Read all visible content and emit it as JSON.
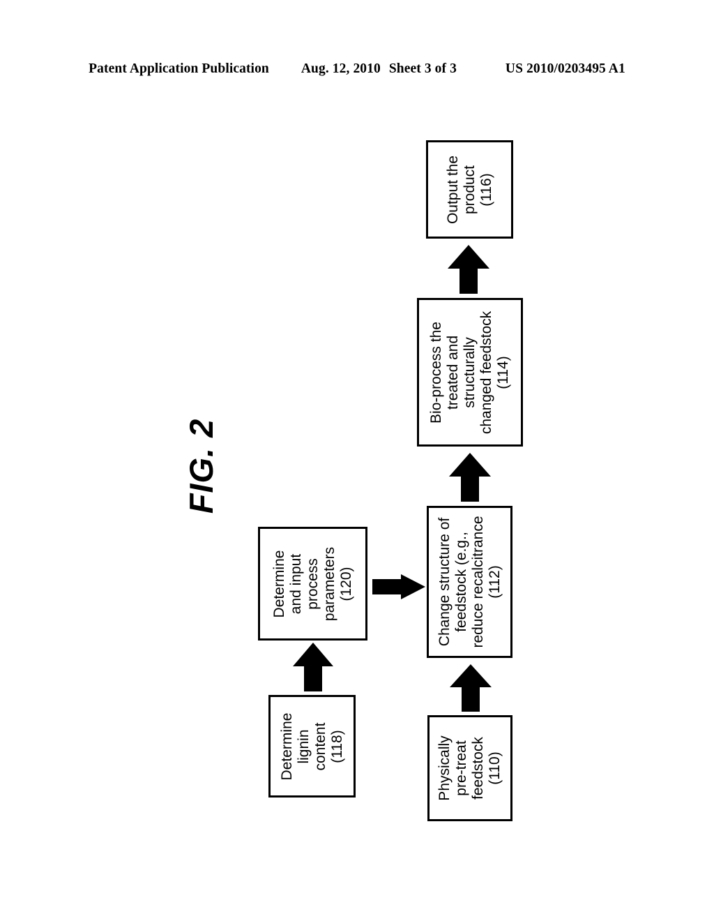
{
  "header": {
    "publication": "Patent Application Publication",
    "date": "Aug. 12, 2010",
    "sheet": "Sheet 3 of 3",
    "patent_number": "US 2010/0203495 A1"
  },
  "figure": {
    "label": "FIG. 2"
  },
  "colors": {
    "ink": "#000000",
    "paper": "#ffffff"
  },
  "flowchart": {
    "boxes": [
      {
        "id": "116",
        "name": "output-product",
        "lines": [
          "Output the",
          "product",
          "(116)"
        ]
      },
      {
        "id": "114",
        "name": "bio-process",
        "lines": [
          "Bio-process the",
          "treated and",
          "structurally",
          "changed feedstock",
          "(114)"
        ]
      },
      {
        "id": "112",
        "name": "change-structure",
        "lines": [
          "Change structure of",
          "feedstock (e.g.,",
          "reduce recalcitrance",
          "(112)"
        ]
      },
      {
        "id": "110",
        "name": "physically-pretreat",
        "lines": [
          "Physically",
          "pre-treat",
          "feedstock",
          "(110)"
        ]
      },
      {
        "id": "120",
        "name": "determine-input-process-parameters",
        "lines": [
          "Determine",
          "and input",
          "process",
          "parameters",
          "(120)"
        ]
      },
      {
        "id": "118",
        "name": "determine-lignin-content",
        "lines": [
          "Determine",
          "lignin",
          "content",
          "(118)"
        ]
      }
    ],
    "arrows": [
      {
        "name": "arrow-114-to-116",
        "from": "114",
        "to": "116",
        "direction": "up"
      },
      {
        "name": "arrow-112-to-114",
        "from": "112",
        "to": "114",
        "direction": "up"
      },
      {
        "name": "arrow-110-to-112",
        "from": "110",
        "to": "112",
        "direction": "up"
      },
      {
        "name": "arrow-118-to-120",
        "from": "118",
        "to": "120",
        "direction": "up"
      },
      {
        "name": "arrow-120-to-112",
        "from": "120",
        "to": "112",
        "direction": "right"
      }
    ]
  }
}
